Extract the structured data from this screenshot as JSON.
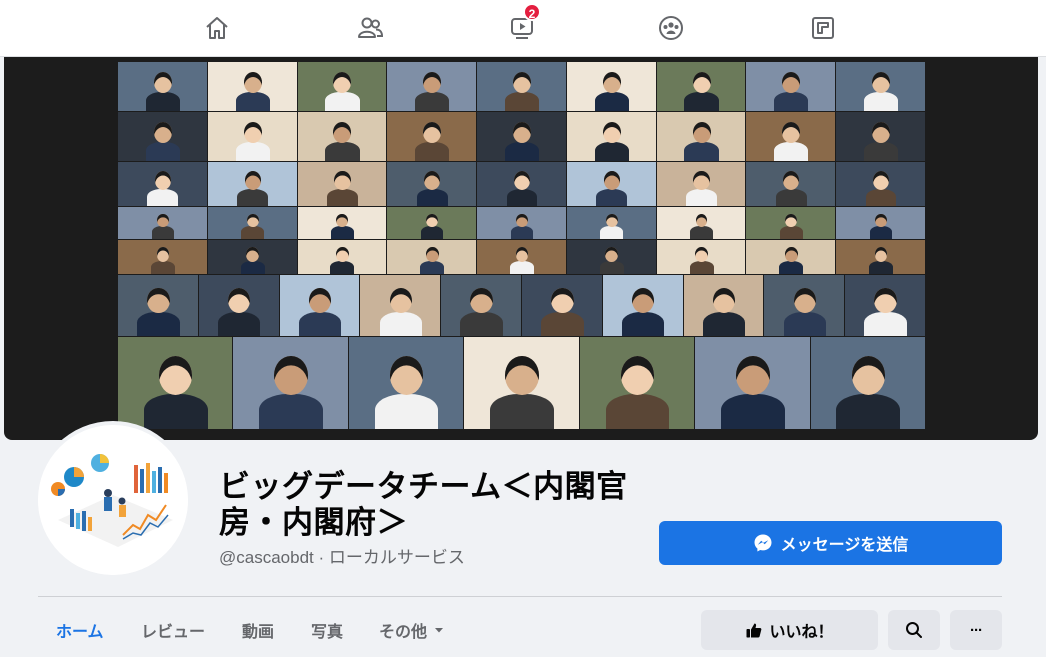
{
  "nav": {
    "icons": [
      "home-icon",
      "friends-icon",
      "watch-icon",
      "groups-icon",
      "gaming-icon"
    ],
    "watch_badge": "2"
  },
  "page": {
    "name_line1": "ビッグデータチーム＜内閣官",
    "name_line2": "房・内閣府＞",
    "handle": "@cascaobdt",
    "separator": "·",
    "category": "ローカルサービス"
  },
  "actions": {
    "message_label": "メッセージを送信",
    "like_label": "いいね！",
    "more_label": "···"
  },
  "tabs": [
    {
      "label": "ホーム",
      "active": true
    },
    {
      "label": "レビュー"
    },
    {
      "label": "動画"
    },
    {
      "label": "写真"
    },
    {
      "label": "その他"
    }
  ],
  "colors": {
    "accent": "#1b74e4",
    "badge": "#e41e3f",
    "button_grey": "#e4e6eb"
  }
}
